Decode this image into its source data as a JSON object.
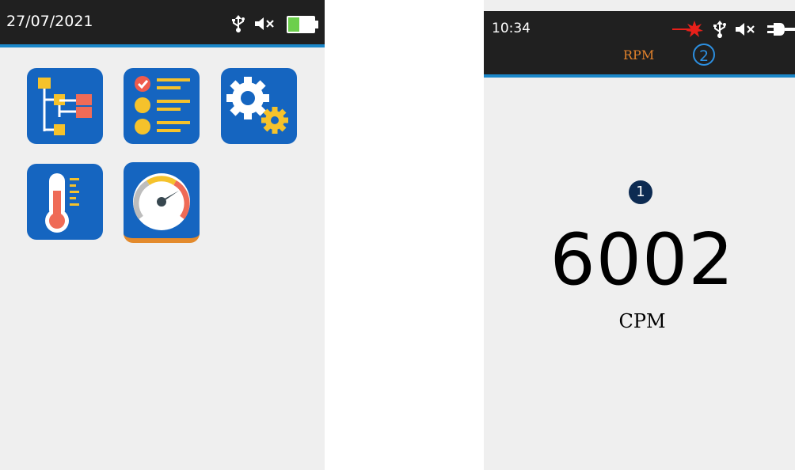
{
  "left_screen": {
    "status": {
      "date": "27/07/2021",
      "icons": [
        "usb-icon",
        "mute-icon",
        "battery-icon"
      ]
    },
    "apps": [
      {
        "name": "tree-hierarchy-app",
        "icon": "tree-icon"
      },
      {
        "name": "checklist-app",
        "icon": "checklist-icon"
      },
      {
        "name": "settings-app",
        "icon": "gears-icon"
      },
      {
        "name": "temperature-app",
        "icon": "thermometer-icon"
      },
      {
        "name": "tachometer-app",
        "icon": "gauge-icon",
        "selected": true
      }
    ]
  },
  "right_screen": {
    "status": {
      "time": "10:34",
      "icons": [
        "laser-icon",
        "usb-icon",
        "mute-icon",
        "plug-icon"
      ],
      "mode_label": "RPM",
      "callout_2": "2"
    },
    "callout_1": "1",
    "reading": "6002",
    "unit": "CPM"
  },
  "colors": {
    "status_bar": "#202020",
    "accent_blue": "#1a87c9",
    "icon_blue": "#1565c0",
    "accent_orange": "#e3822b",
    "screen_bg": "#efefef"
  }
}
